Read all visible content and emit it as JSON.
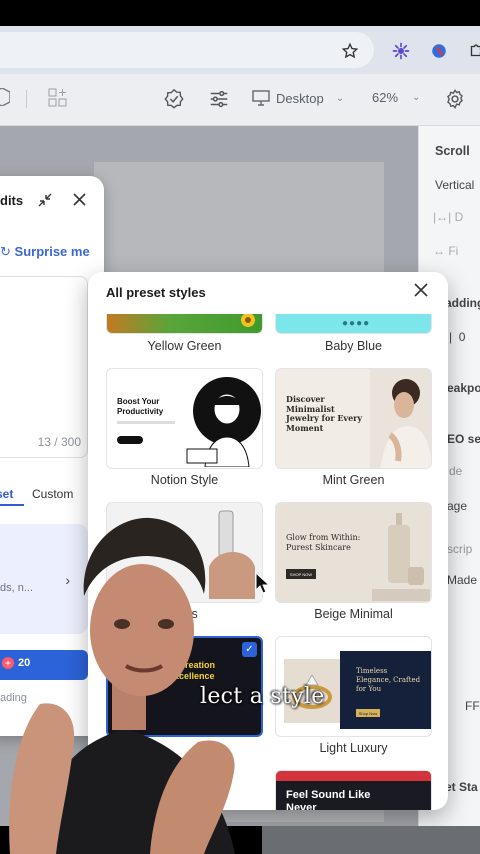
{
  "browser": {
    "bookmark_icon": "star-icon",
    "extensions": [
      "sparkle-extension-icon",
      "globe-extension-icon",
      "puzzle-extension-icon"
    ]
  },
  "toolbar": {
    "viewport_label": "Desktop",
    "zoom_label": "62%"
  },
  "right_panel": {
    "scroll_label": "Scroll",
    "vertical_label": "Vertical",
    "padding_label": "adding",
    "padding_value": "0",
    "breakpoint_label": "eakpo",
    "seo_label": "EO set",
    "de_label": "de",
    "image_label": "age",
    "description_label": "scrip",
    "made_label": "Made i",
    "ff_label": "FF",
    "set_label": "et Sta",
    "d_label": "D",
    "fi_label": "Fi"
  },
  "edits_dialog": {
    "title": "dits",
    "surprise_label": "Surprise me",
    "counter": "13 / 300",
    "tab_preset": "set",
    "tab_custom": "Custom",
    "style_hint": "ds, n...",
    "credits": "20",
    "loading_label": "ading"
  },
  "modal": {
    "title": "All preset styles",
    "styles": [
      {
        "label": "Yellow Green"
      },
      {
        "label": "Baby Blue"
      },
      {
        "label": "Notion Style",
        "headline": "Boost Your Productivity"
      },
      {
        "label": "Mint Green",
        "headline": "Discover Minimalist Jewelry for Every Moment"
      },
      {
        "label": "ocus"
      },
      {
        "label": "Beige Minimal",
        "headline": "Glow from Within: Purest Skincare",
        "button": "SHOP NOW"
      },
      {
        "label": "",
        "headline": "ts Creation Excellence"
      },
      {
        "label": "Light Luxury",
        "headline": "Timeless Elegance, Crafted for You",
        "button": "Shop Now"
      },
      {
        "label": "",
        "headline": "Feel Sound Like Never"
      }
    ]
  },
  "caption": "lect a style",
  "colors": {
    "accent": "#2c63d9",
    "modal_bg": "#ffffff"
  }
}
